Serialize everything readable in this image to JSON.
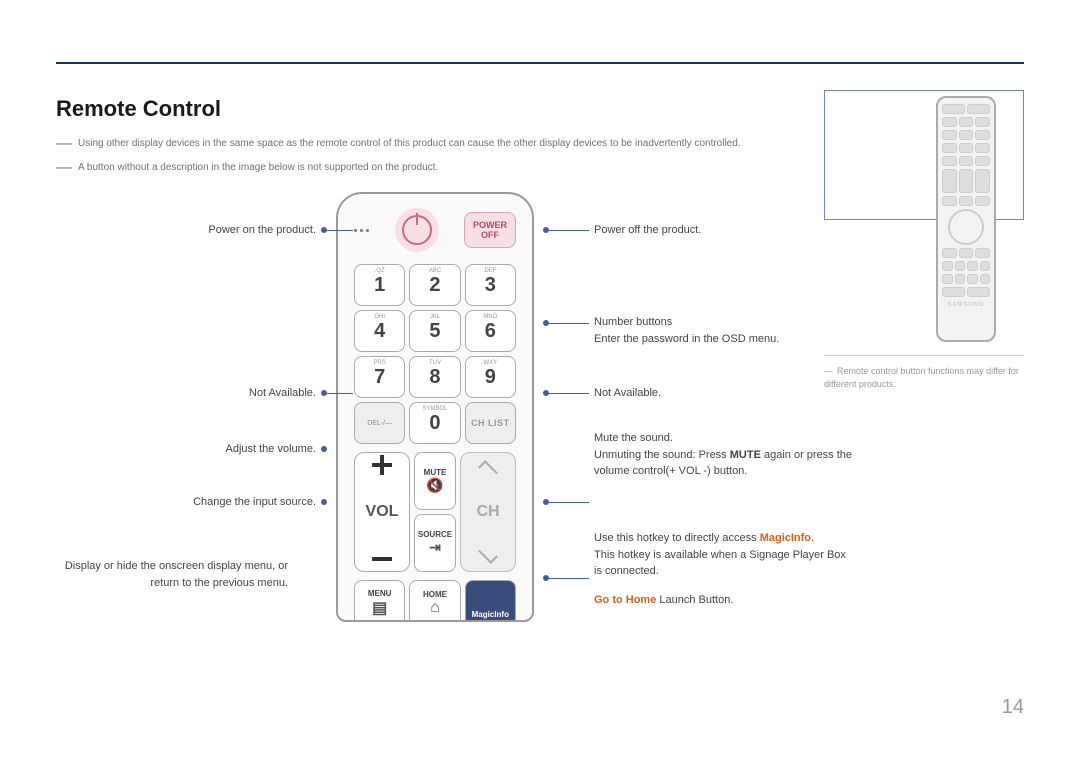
{
  "title": "Remote Control",
  "notes": {
    "line1": "Using other display devices in the same space as the remote control of this product can cause the other display devices to be inadvertently controlled.",
    "line2": "A button without a description in the image below is not supported on the product."
  },
  "remote": {
    "power_off_label1": "POWER",
    "power_off_label2": "OFF",
    "keys": {
      "k1_sup": ".QZ",
      "k1": "1",
      "k2_sup": "ABC",
      "k2": "2",
      "k3_sup": "DEF",
      "k3": "3",
      "k4_sup": "GHI",
      "k4": "4",
      "k5_sup": "JKL",
      "k5": "5",
      "k6_sup": "MNO",
      "k6": "6",
      "k7_sup": "PRS",
      "k7": "7",
      "k8_sup": "TUV",
      "k8": "8",
      "k9_sup": "WXY",
      "k9": "9",
      "del": "DEL-/—",
      "k0_sup": "SYMBOL",
      "k0": "0",
      "chlist": "CH LIST"
    },
    "vol_label": "VOL",
    "ch_label": "CH",
    "mute": "MUTE",
    "source": "SOURCE",
    "menu": "MENU",
    "home": "HOME",
    "magicinfo": "MagicInfo"
  },
  "left": {
    "power_on": "Power on the product.",
    "not_avail": "Not Available.",
    "volume": "Adjust the volume.",
    "source": "Change the input source.",
    "menu1": "Display or hide the onscreen display menu, or",
    "menu2": "return to the previous menu."
  },
  "right": {
    "power_off": "Power off the product.",
    "numbers1": "Number buttons",
    "numbers2": "Enter the password in the OSD menu.",
    "not_avail": "Not Available.",
    "mute1": "Mute the sound.",
    "mute2a": "Unmuting the sound: Press ",
    "mute2b": "MUTE",
    "mute2c": " again or press the volume control(+ VOL -) button.",
    "magic1a": "Use this hotkey to directly access ",
    "magic1b": "MagicInfo",
    "magic1c": ".",
    "magic2": "This hotkey is available when a Signage Player Box is connected.",
    "home_a": "Go to Home",
    "home_b": " Launch Button."
  },
  "side_note": "Remote control button functions may differ for different products.",
  "brand": "SAMSUNG",
  "page": "14"
}
